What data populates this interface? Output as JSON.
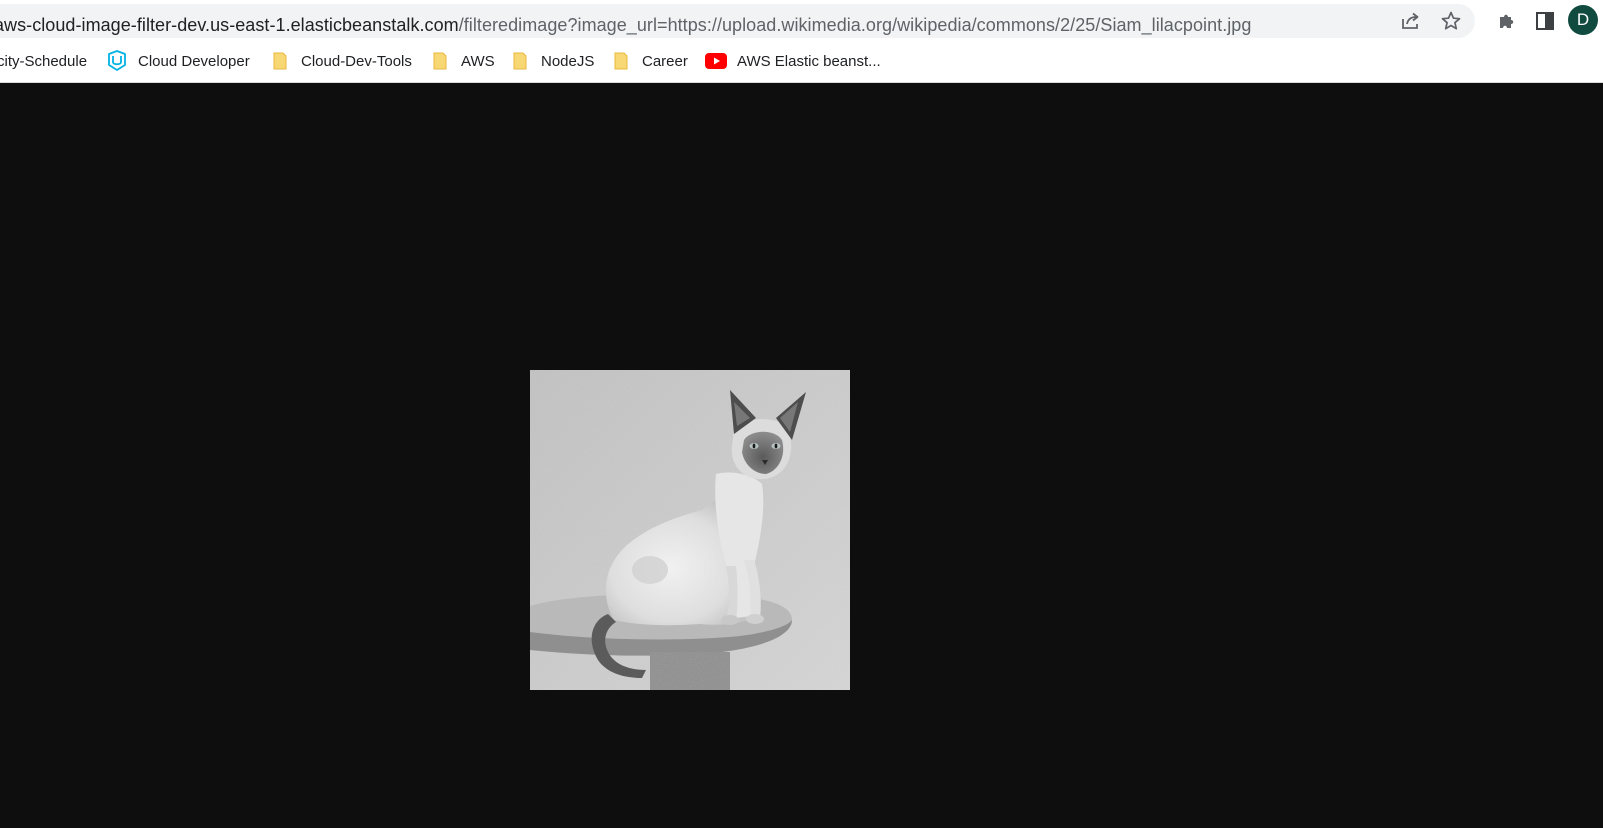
{
  "address_bar": {
    "host": "aws-cloud-image-filter-dev.us-east-1.elasticbeanstalk.com",
    "path": "/filteredimage?image_url=https://upload.wikimedia.org/wikipedia/commons/2/25/Siam_lilacpoint.jpg"
  },
  "icons": {
    "share": "share-icon",
    "bookmark_star": "star-icon",
    "extensions": "puzzle-icon",
    "side_panel": "side-panel-icon"
  },
  "profile": {
    "initial": "D",
    "color": "#114b3f"
  },
  "bookmarks": [
    {
      "label": "city-Schedule",
      "icon": "none"
    },
    {
      "label": "Cloud Developer",
      "icon": "udacity-logo"
    },
    {
      "label": "Cloud-Dev-Tools",
      "icon": "folder-icon"
    },
    {
      "label": "AWS",
      "icon": "folder-icon"
    },
    {
      "label": "NodeJS",
      "icon": "folder-icon"
    },
    {
      "label": "Career",
      "icon": "folder-icon"
    },
    {
      "label": "AWS Elastic beanst...",
      "icon": "youtube-icon"
    }
  ],
  "page": {
    "background": "#0e0e0e",
    "image_description_icon": "grayscale-photo"
  }
}
